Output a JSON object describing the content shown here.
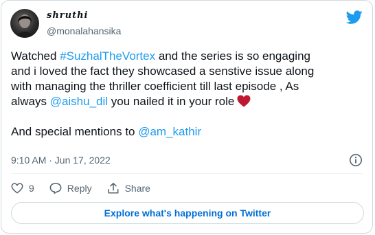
{
  "author": {
    "display_name": "shruthi",
    "handle": "@monalahansika"
  },
  "tweet": {
    "line1_pre": "Watched ",
    "hashtag": "#SuzhalTheVortex",
    "line1_post": "  and the series is so engaging",
    "line2": "and i loved the fact they showcased a senstive issue along",
    "line3": "with managing the thriller coefficient till last episode , As",
    "line4_pre": "always ",
    "mention1": "@aishu_dil",
    "line4_post": " you nailed it in your role",
    "line5_pre": "And special mentions to ",
    "mention2": "@am_kathir"
  },
  "meta": {
    "timestamp": "9:10 AM · Jun 17, 2022"
  },
  "actions": {
    "like_count": "9",
    "reply_label": "Reply",
    "share_label": "Share"
  },
  "cta": {
    "explore_label": "Explore what's happening on Twitter"
  },
  "colors": {
    "link": "#1d9bf0",
    "heart": "#be1931",
    "cta_text": "#006fd6"
  },
  "icons": [
    "twitter-bird-icon",
    "info-icon",
    "heart-outline-icon",
    "reply-icon",
    "share-icon",
    "red-heart-emoji-icon"
  ]
}
